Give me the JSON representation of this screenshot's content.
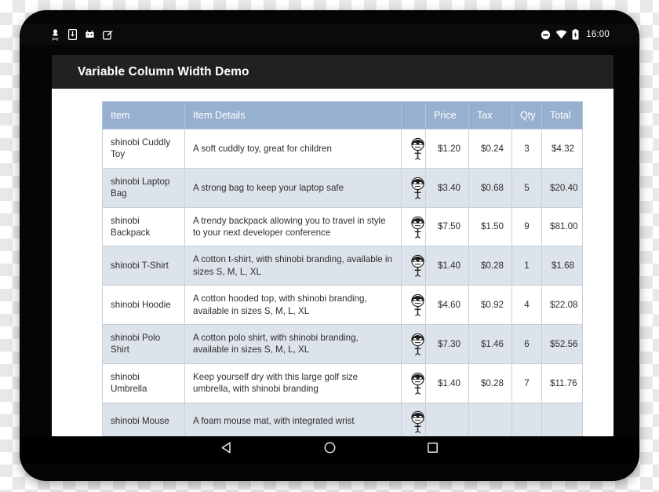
{
  "status_bar": {
    "clock": "16:00",
    "left_icons": [
      "pay-icon",
      "download-icon",
      "android-robot-icon",
      "screenshot-edit-icon"
    ],
    "right_icons": [
      "do-not-disturb-icon",
      "wifi-icon",
      "battery-charging-icon"
    ]
  },
  "app_bar": {
    "title": "Variable Column Width Demo"
  },
  "table": {
    "headers": {
      "item": "Item",
      "details": "Item Details",
      "image": "",
      "price": "Price",
      "tax": "Tax",
      "qty": "Qty",
      "total": "Total"
    },
    "rows": [
      {
        "item": "shinobi Cuddly Toy",
        "details": "A soft cuddly toy, great for children",
        "image": "shinobi-avatar-icon",
        "price": "$1.20",
        "tax": "$0.24",
        "qty": "3",
        "total": "$4.32"
      },
      {
        "item": "shinobi Laptop Bag",
        "details": "A strong bag to keep your laptop safe",
        "image": "shinobi-avatar-icon",
        "price": "$3.40",
        "tax": "$0.68",
        "qty": "5",
        "total": "$20.40"
      },
      {
        "item": "shinobi Backpack",
        "details": "A trendy backpack allowing you to travel in style to your next developer conference",
        "image": "shinobi-avatar-icon",
        "price": "$7.50",
        "tax": "$1.50",
        "qty": "9",
        "total": "$81.00"
      },
      {
        "item": "shinobi T-Shirt",
        "details": "A cotton t-shirt, with shinobi branding, available in sizes S, M, L, XL",
        "image": "shinobi-avatar-icon",
        "price": "$1.40",
        "tax": "$0.28",
        "qty": "1",
        "total": "$1.68"
      },
      {
        "item": "shinobi Hoodie",
        "details": "A cotton hooded top, with shinobi branding, available in sizes S, M, L, XL",
        "image": "shinobi-avatar-icon",
        "price": "$4.60",
        "tax": "$0.92",
        "qty": "4",
        "total": "$22.08"
      },
      {
        "item": "shinobi Polo Shirt",
        "details": "A cotton polo shirt, with shinobi branding, available in sizes S, M, L, XL",
        "image": "shinobi-avatar-icon",
        "price": "$7.30",
        "tax": "$1.46",
        "qty": "6",
        "total": "$52.56"
      },
      {
        "item": "shinobi Umbrella",
        "details": "Keep yourself dry with this large golf size umbrella, with shinobi branding",
        "image": "shinobi-avatar-icon",
        "price": "$1.40",
        "tax": "$0.28",
        "qty": "7",
        "total": "$11.76"
      },
      {
        "item": "shinobi Mouse",
        "details": "A foam mouse mat, with integrated wrist",
        "image": "shinobi-avatar-icon",
        "price": "",
        "tax": "",
        "qty": "",
        "total": ""
      }
    ]
  },
  "nav_bar": {
    "back": "back-triangle-icon",
    "home": "home-circle-icon",
    "recents": "recents-square-icon"
  },
  "colors": {
    "header_blue": "#97b0d0",
    "row_alt": "#dde3ea",
    "app_bar": "#212121",
    "grid_line": "#c9cfd6"
  }
}
